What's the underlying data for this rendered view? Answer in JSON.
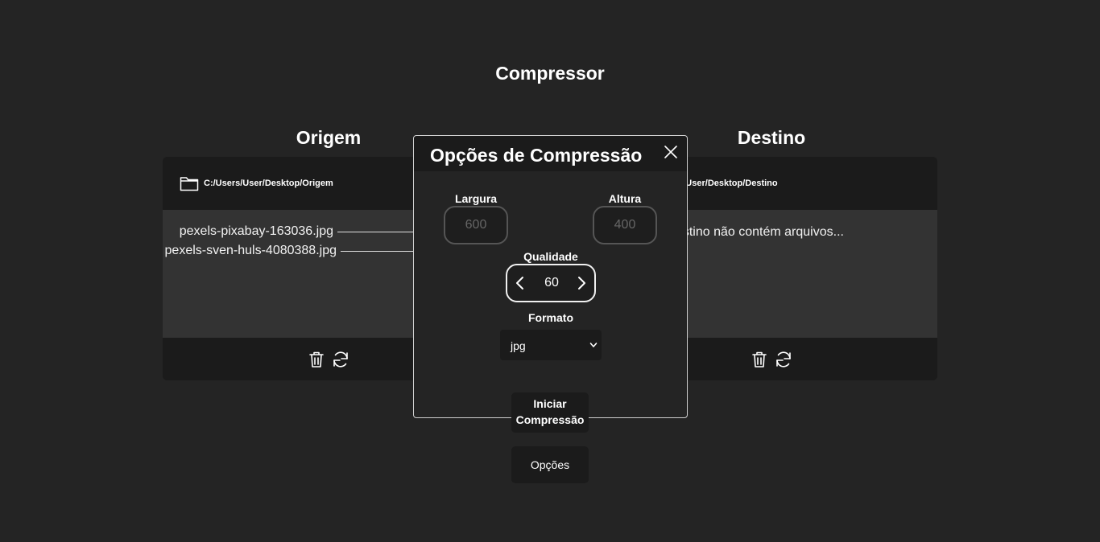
{
  "app": {
    "title": "Compressor"
  },
  "origem": {
    "title": "Origem",
    "path": "C:/Users/User/Desktop/Origem",
    "files": [
      "pexels-pixabay-163036.jpg",
      "pexels-sven-huls-4080388.jpg"
    ]
  },
  "destino": {
    "title": "Destino",
    "path": "C:/Users/User/Desktop/Destino",
    "empty_message": "A pasta de destino não contém arquivos..."
  },
  "buttons": {
    "start_label": "Iniciar Compressão",
    "options_label": "Opções"
  },
  "modal": {
    "title": "Opções de Compressão",
    "largura_label": "Largura",
    "largura_placeholder": "600",
    "altura_label": "Altura",
    "altura_placeholder": "400",
    "qualidade_label": "Qualidade",
    "qualidade_value": "60",
    "formato_label": "Formato",
    "formato_value": "jpg"
  },
  "icons": {
    "folder": "folder-icon",
    "trash": "trash-icon",
    "refresh": "refresh-icon",
    "close": "close-icon",
    "chevron_left": "chevron-left-icon",
    "chevron_right": "chevron-right-icon",
    "chevron_down": "chevron-down-icon"
  },
  "colors": {
    "background": "#242424",
    "panel": "#1b1b1b",
    "panel_body": "#333333",
    "text": "#ffffff"
  }
}
